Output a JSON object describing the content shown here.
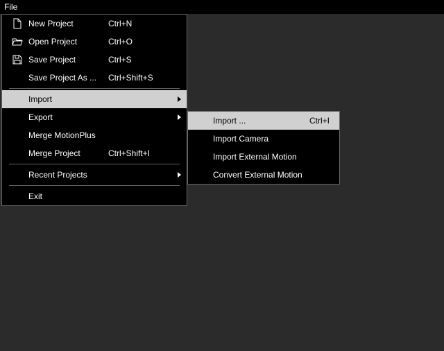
{
  "menubar": {
    "file": "File"
  },
  "file_menu": {
    "new_project": {
      "label": "New Project",
      "shortcut": "Ctrl+N"
    },
    "open_project": {
      "label": "Open Project",
      "shortcut": "Ctrl+O"
    },
    "save_project": {
      "label": "Save Project",
      "shortcut": "Ctrl+S"
    },
    "save_project_as": {
      "label": "Save Project As ...",
      "shortcut": "Ctrl+Shift+S"
    },
    "import": {
      "label": "Import",
      "shortcut": ""
    },
    "export": {
      "label": "Export",
      "shortcut": ""
    },
    "merge_motionplus": {
      "label": "Merge MotionPlus",
      "shortcut": ""
    },
    "merge_project": {
      "label": "Merge Project",
      "shortcut": "Ctrl+Shift+I"
    },
    "recent_projects": {
      "label": "Recent Projects",
      "shortcut": ""
    },
    "exit": {
      "label": "Exit",
      "shortcut": ""
    }
  },
  "import_submenu": {
    "import": {
      "label": "Import ...",
      "shortcut": "Ctrl+I"
    },
    "import_camera": {
      "label": "Import Camera",
      "shortcut": ""
    },
    "import_external_motion": {
      "label": "Import External Motion",
      "shortcut": ""
    },
    "convert_external_motion": {
      "label": "Convert External Motion",
      "shortcut": ""
    }
  }
}
